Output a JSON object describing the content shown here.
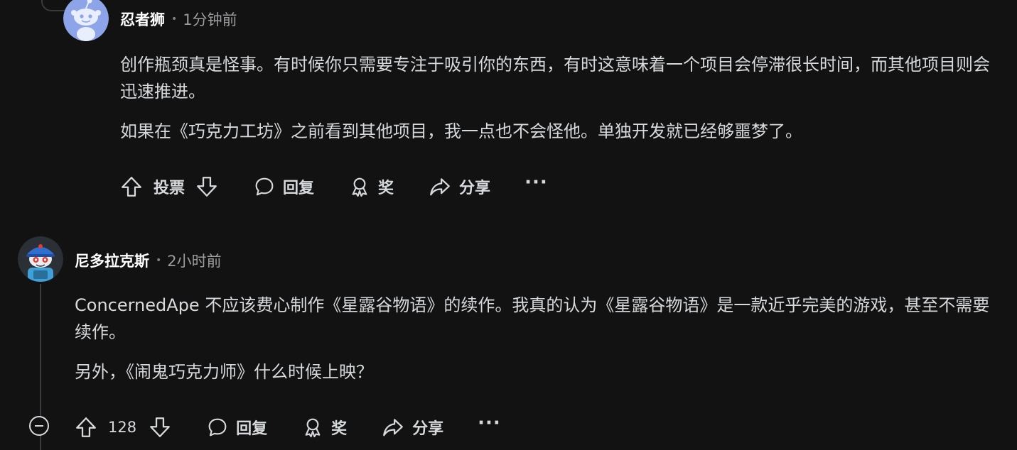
{
  "comments": [
    {
      "author": "忍者狮",
      "separator": "•",
      "time": "1分钟前",
      "paragraphs": [
        "创作瓶颈真是怪事。有时候你只需要专注于吸引你的东西，有时这意味着一个项目会停滞很长时间，而其他项目则会迅速推进。",
        "如果在《巧克力工坊》之前看到其他项目，我一点也不会怪他。单独开发就已经够噩梦了。"
      ],
      "vote_label": "投票",
      "reply_label": "回复",
      "award_label": "奖",
      "share_label": "分享",
      "more_label": "···"
    },
    {
      "author": "尼多拉克斯",
      "separator": "•",
      "time": "2小时前",
      "paragraphs": [
        "ConcernedApe 不应该费心制作《星露谷物语》的续作。我真的认为《星露谷物语》是一款近乎完美的游戏，甚至不需要续作。",
        "另外，《闹鬼巧克力师》什么时候上映？"
      ],
      "vote_count": "128",
      "reply_label": "回复",
      "award_label": "奖",
      "share_label": "分享",
      "more_label": "···"
    }
  ],
  "icons": {
    "upvote": "arrow-up-icon",
    "downvote": "arrow-down-icon",
    "reply": "speech-bubble-icon",
    "award": "award-ribbon-icon",
    "share": "share-arrow-icon",
    "collapse": "minus-circle-icon"
  },
  "colors": {
    "background": "#121212",
    "text": "#d7dadc",
    "muted": "#9a9c9e",
    "thread": "#3a3a3c",
    "snoo_blue": "#8ea4e8"
  }
}
